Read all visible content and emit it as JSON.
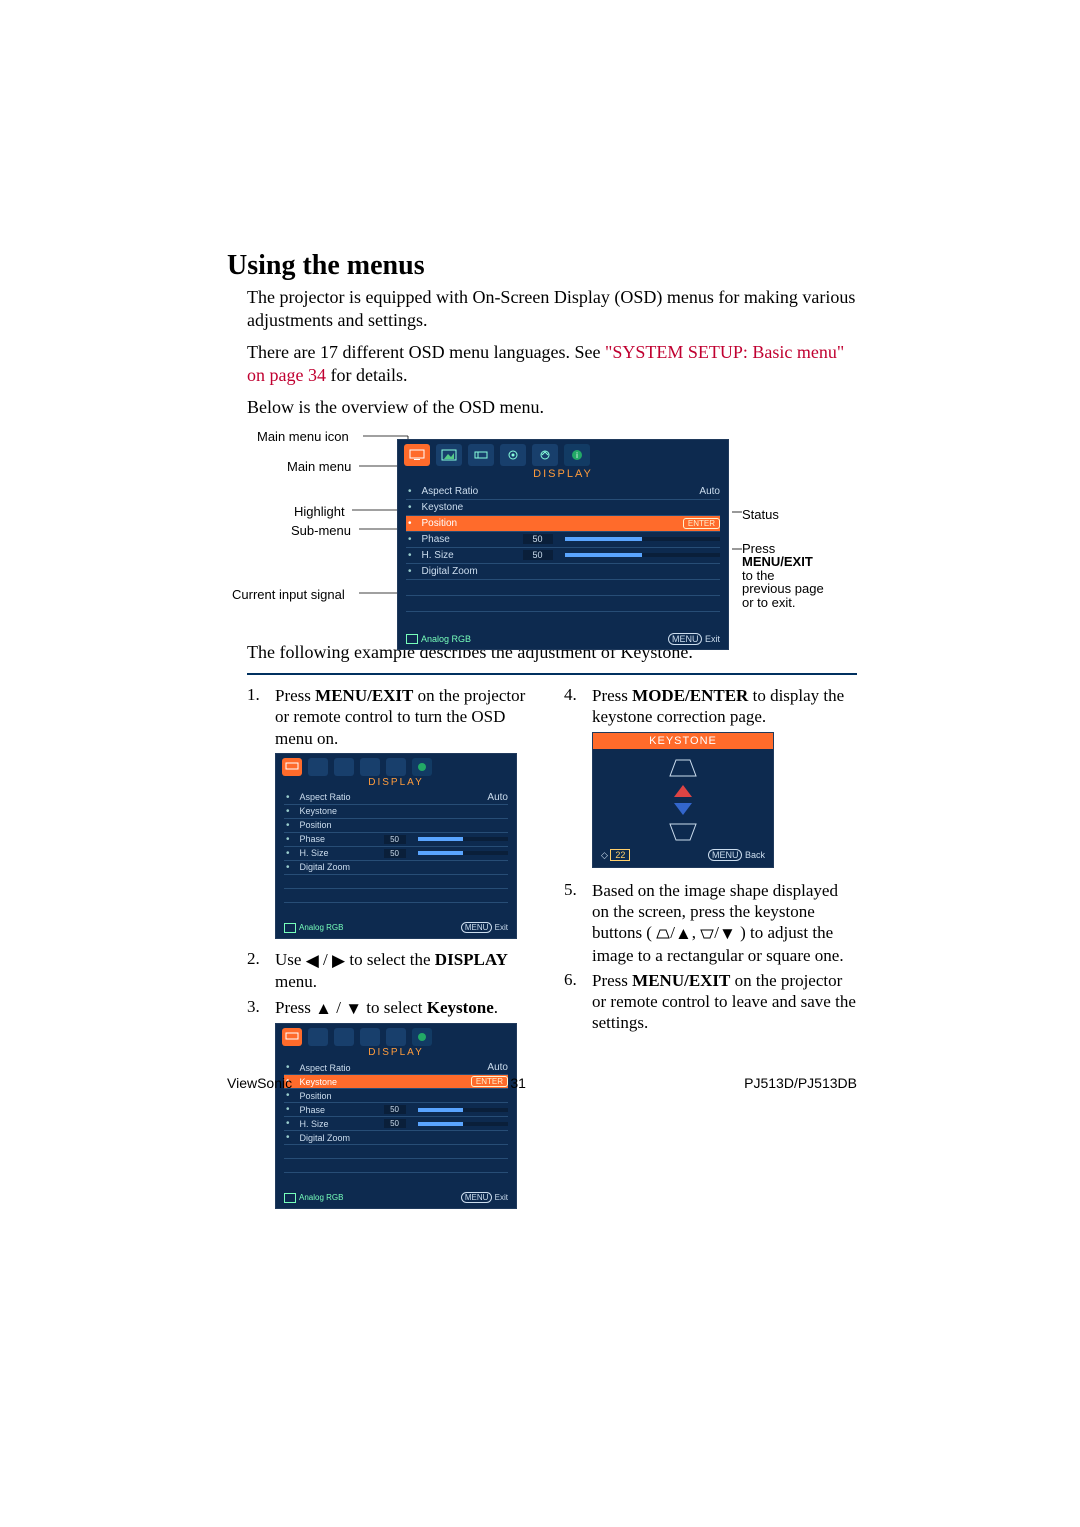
{
  "heading": "Using the menus",
  "p1": "The projector is equipped with On-Screen Display (OSD) menus for making various adjustments and settings.",
  "p2a": "There are 17 different OSD menu languages. See ",
  "p2_link": "\"SYSTEM SETUP: Basic menu\" on page 34",
  "p2b": " for details.",
  "p3": "Below is the overview of the OSD menu.",
  "annot_labels": {
    "main_menu_icon": "Main menu icon",
    "main_menu": "Main menu",
    "highlight": "Highlight",
    "sub_menu": "Sub-menu",
    "current_input": "Current input signal",
    "status": "Status",
    "press_prefix": "Press ",
    "press_bold": "MENU/EXIT",
    "press_suffix": " to the previous page or to exit."
  },
  "osd": {
    "menu_name": "DISPLAY",
    "items": [
      {
        "name": "Aspect Ratio",
        "right": "Auto"
      },
      {
        "name": "Keystone"
      },
      {
        "name": "Position",
        "enter": "ENTER"
      },
      {
        "name": "Phase",
        "val": "50",
        "slider": true
      },
      {
        "name": "H. Size",
        "val": "50",
        "slider": true
      },
      {
        "name": "Digital Zoom"
      }
    ],
    "source": "Analog RGB",
    "exit_label": "Exit",
    "exit_btn": "MENU"
  },
  "p4": "The following example describes the adjustment of Keystone.",
  "steps_left": [
    {
      "n": "1.",
      "pre": "Press ",
      "b": "MENU/EXIT",
      "post": " on the projector or remote control to turn the OSD menu on."
    },
    {
      "n": "2.",
      "pre": "Use ",
      "arrows": "lr",
      "mid": "  to select the ",
      "b": "DISPLAY",
      "post": " menu."
    },
    {
      "n": "3.",
      "pre": "Press ",
      "arrows": "ud",
      "mid": " to select ",
      "b": "Keystone",
      "post": "."
    }
  ],
  "steps_right": [
    {
      "n": "4.",
      "pre": "Press ",
      "b": "MODE/ENTER",
      "post": " to display the keystone correction page."
    },
    {
      "n": "5.",
      "txt": "Based on the image shape displayed on the screen, press the keystone buttons (",
      "key_icons": true,
      "txt2": ") to adjust the image to a rectangular or square one."
    },
    {
      "n": "6.",
      "pre": "Press ",
      "b": "MENU/EXIT",
      "post": " on the projector or remote control to leave and save the settings."
    }
  ],
  "keystone": {
    "title": "KEYSTONE",
    "value": "22",
    "back_btn": "MENU",
    "back_label": "Back"
  },
  "footer": {
    "left": "ViewSonic",
    "center": "31",
    "right": "PJ513D/PJ513DB"
  }
}
